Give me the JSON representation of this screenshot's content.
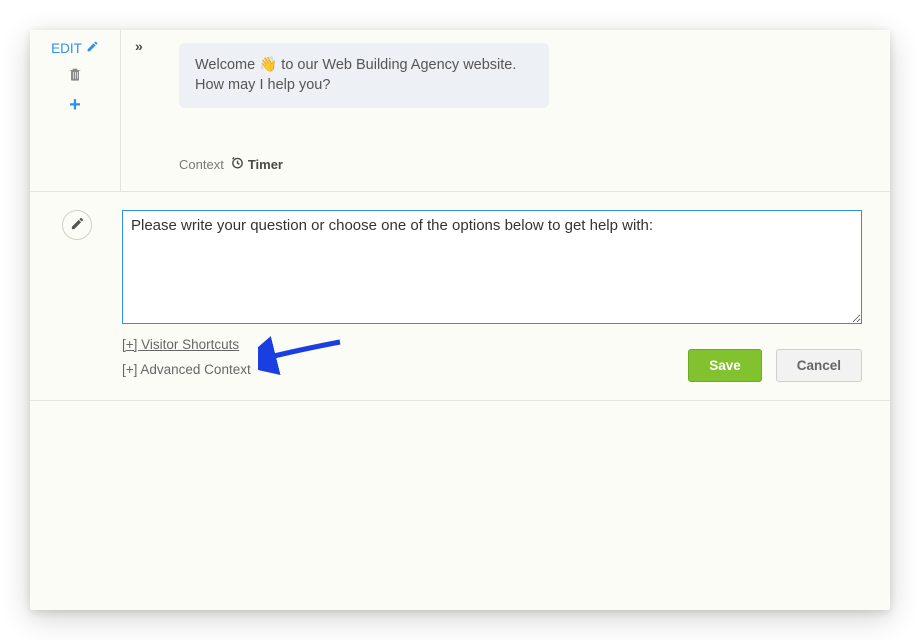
{
  "tools": {
    "edit_label": "EDIT"
  },
  "welcome": {
    "text_before": "Welcome ",
    "emoji": "👋",
    "text_after": "  to our Web Building Agency website. How may I help you?"
  },
  "context": {
    "label": "Context",
    "timer_label": "Timer"
  },
  "textarea": {
    "value": "Please write your question or choose one of the options below to get help with:"
  },
  "links": {
    "visitor_shortcuts": "[+] Visitor Shortcuts",
    "advanced_context": "[+] Advanced Context"
  },
  "buttons": {
    "save": "Save",
    "cancel": "Cancel"
  },
  "colors": {
    "accent_blue": "#2f8fec",
    "save_green": "#81c22e",
    "arrow_blue": "#1a3fe0"
  }
}
